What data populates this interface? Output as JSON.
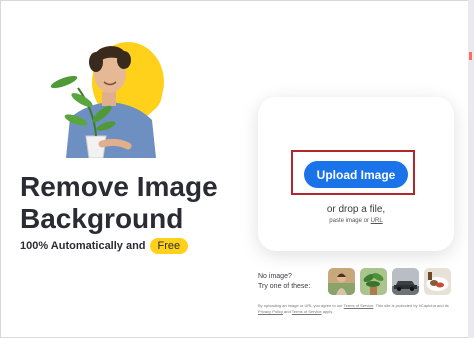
{
  "hero": {
    "title_line1": "Remove Image",
    "title_line2": "Background",
    "subtitle": "100% Automatically and",
    "badge": "Free"
  },
  "upload": {
    "button_label": "Upload Image",
    "drop_text": "or drop a file,",
    "paste_prefix": "paste image or",
    "paste_link": "URL"
  },
  "samples": {
    "line1": "No image?",
    "line2": "Try one of these:",
    "items": [
      "sample-woman",
      "sample-plant",
      "sample-car",
      "sample-food"
    ]
  },
  "legal": {
    "part1": "By uploading an image or URL you agree to our",
    "terms": "Terms of Service",
    "part2": ". This site is protected by hCaptcha and its",
    "privacy": "Privacy Policy",
    "part3": "and",
    "terms2": "Terms of Service",
    "part4": "apply."
  },
  "colors": {
    "accent_yellow": "#ffd11a",
    "button_blue": "#1a73e8",
    "highlight_red": "#b3262b",
    "text_dark": "#2b2b33"
  }
}
